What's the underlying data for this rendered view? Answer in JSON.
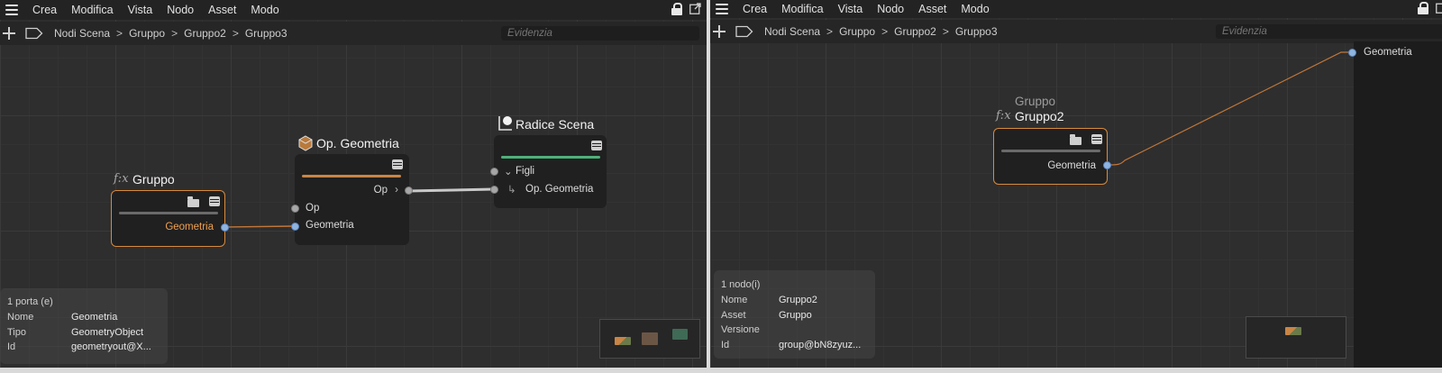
{
  "menu": {
    "items": [
      "Crea",
      "Modifica",
      "Vista",
      "Nodo",
      "Asset",
      "Modo"
    ]
  },
  "left": {
    "breadcrumb": [
      "Nodi Scena",
      "Gruppo",
      "Gruppo2",
      "Gruppo3"
    ],
    "search_placeholder": "Evidenzia",
    "nodes": {
      "gruppo": {
        "title": "Gruppo",
        "port": "Geometria"
      },
      "opgeo": {
        "title": "Op. Geometria",
        "out_port": "Op",
        "in_ports": [
          "Op",
          "Geometria"
        ]
      },
      "radice": {
        "title": "Radice Scena",
        "ports": [
          "Figli",
          "Op. Geometria"
        ]
      }
    },
    "info": {
      "title": "1 porta (e)",
      "rows": [
        {
          "key": "Nome",
          "value": "Geometria"
        },
        {
          "key": "Tipo",
          "value": "GeometryObject"
        },
        {
          "key": "Id",
          "value": "geometryout@X..."
        }
      ]
    }
  },
  "right": {
    "breadcrumb": [
      "Nodi Scena",
      "Gruppo",
      "Gruppo2",
      "Gruppo3"
    ],
    "search_placeholder": "Evidenzia",
    "node": {
      "subtitle": "Gruppo",
      "title": "Gruppo2",
      "port": "Geometria"
    },
    "edge_port": "Geometria",
    "info": {
      "title": "1 nodo(i)",
      "rows": [
        {
          "key": "Nome",
          "value": "Gruppo2"
        },
        {
          "key": "Asset",
          "value": "Gruppo"
        },
        {
          "key": "Versione",
          "value": ""
        },
        {
          "key": "Id",
          "value": "group@bN8zyuz..."
        }
      ]
    }
  },
  "colors": {
    "selected_outline": "#d88a3a",
    "port_blue": "#8fb4e0",
    "bar_orange": "#c98545",
    "bar_green": "#4fb07a",
    "wire_orange": "#c2773a",
    "wire_grey": "#c9c9c9"
  },
  "icons": [
    "hamburger-icon",
    "lock-icon",
    "popout-icon",
    "plus-icon",
    "tag-icon",
    "fx-icon",
    "folder-icon",
    "list-icon",
    "geometry-op-icon",
    "scene-root-icon"
  ]
}
